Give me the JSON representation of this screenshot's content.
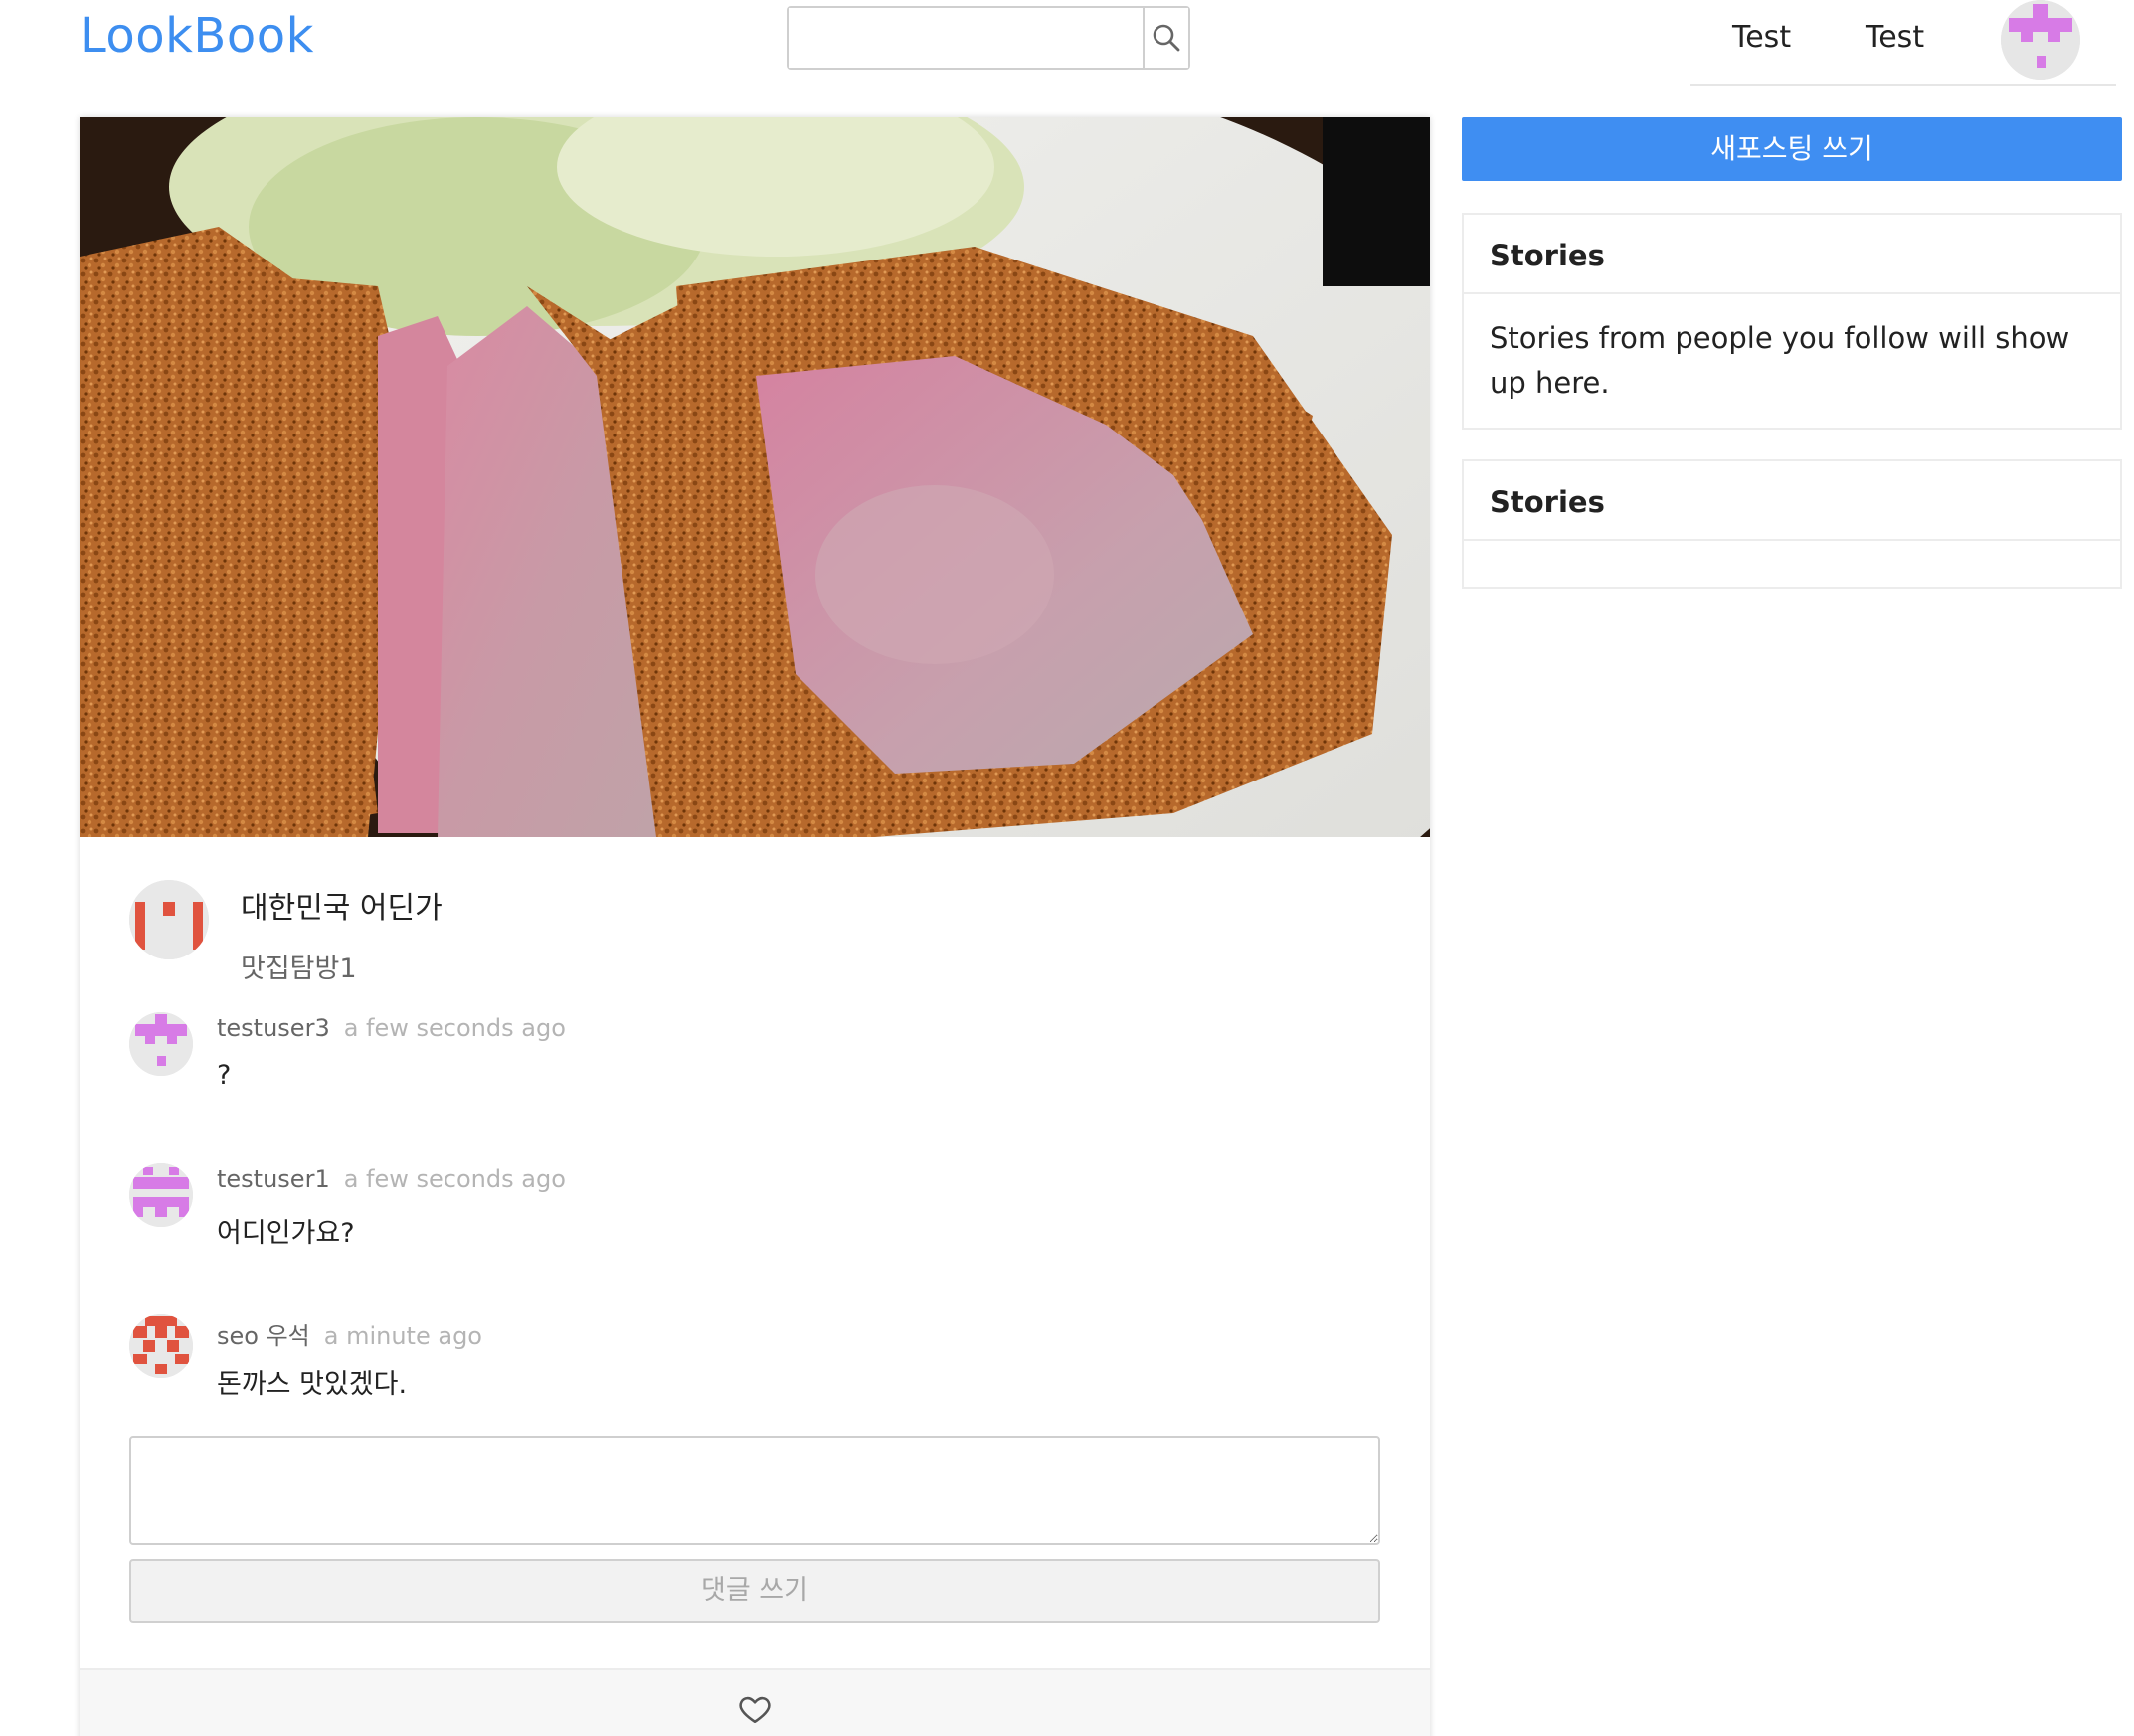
{
  "header": {
    "logo": "LookBook",
    "search_placeholder": "",
    "search_icon": "search-icon",
    "nav_links": [
      "Test",
      "Test"
    ],
    "profile_avatar": "pixel-avatar-violet"
  },
  "post": {
    "photo": "tonkatsu-photo",
    "author_avatar": "pixel-avatar-red",
    "place": "대한민국 어딘가",
    "caption": "맛집탐방1",
    "comments": [
      {
        "user": "testuser3",
        "time": "a few seconds ago",
        "text": "?",
        "avatar": "pixel-avatar-violet"
      },
      {
        "user": "testuser1",
        "time": "a few seconds ago",
        "text": "어디인가요?",
        "avatar": "pixel-avatar-violet"
      },
      {
        "user": "seo 우석",
        "time": "a minute ago",
        "text": "돈까스 맛있겠다.",
        "avatar": "pixel-avatar-red"
      }
    ],
    "comment_input_value": "",
    "comment_button": "댓글 쓰기",
    "like_icon": "heart-outline-icon"
  },
  "sidebar": {
    "new_post_button": "새포스팅 쓰기",
    "panels": [
      {
        "title": "Stories",
        "body": "Stories from people you follow will show up here."
      },
      {
        "title": "Stories",
        "body": ""
      }
    ]
  },
  "colors": {
    "brand": "#3d8ef0",
    "primary_button": "#3f8ef2",
    "avatar_violet": "#d77be6",
    "avatar_red": "#e0533f",
    "muted_text": "#b4b4b4"
  }
}
